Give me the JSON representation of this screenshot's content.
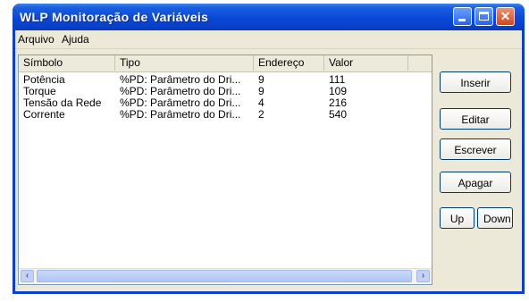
{
  "window": {
    "title": "WLP Monitoração de Variáveis"
  },
  "menu": {
    "items": [
      "Arquivo",
      "Ajuda"
    ]
  },
  "table": {
    "columns": [
      "Símbolo",
      "Tipo",
      "Endereço",
      "Valor"
    ],
    "rows": [
      [
        "Potência",
        "%PD: Parâmetro do Dri...",
        "9",
        "111"
      ],
      [
        "Torque",
        "%PD: Parâmetro do Dri...",
        "9",
        "109"
      ],
      [
        "Tensão da Rede",
        "%PD: Parâmetro do Dri...",
        "4",
        "216"
      ],
      [
        "Corrente",
        "%PD: Parâmetro do Dri...",
        "2",
        "540"
      ]
    ]
  },
  "buttons": {
    "insert": "Inserir",
    "edit": "Editar",
    "write": "Escrever",
    "delete": "Apagar",
    "up": "Up",
    "down": "Down"
  },
  "icons": {
    "minimize": "minimize-icon",
    "maximize": "maximize-icon",
    "close": "close-icon",
    "scroll_left": "arrow-left-icon",
    "scroll_right": "arrow-right-icon"
  }
}
